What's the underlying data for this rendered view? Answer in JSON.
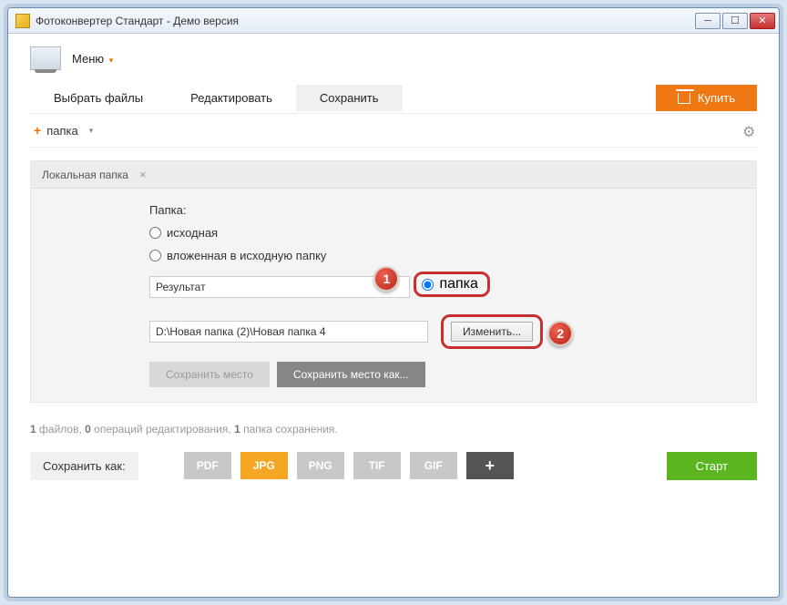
{
  "window": {
    "title": "Фотоконвертер Стандарт - Демо версия"
  },
  "menu": {
    "label": "Меню"
  },
  "tabs": {
    "select": "Выбрать файлы",
    "edit": "Редактировать",
    "save": "Сохранить"
  },
  "buy": "Купить",
  "toolbar": {
    "add_folder": "папка"
  },
  "panel": {
    "tab_label": "Локальная папка"
  },
  "form": {
    "folder_label": "Папка:",
    "radio_source": "исходная",
    "radio_nested": "вложенная в исходную папку",
    "nested_value": "Результат",
    "radio_folder": "папка",
    "path_value": "D:\\Новая папка (2)\\Новая папка 4",
    "change_btn": "Изменить...",
    "save_place": "Сохранить место",
    "save_place_as": "Сохранить место как..."
  },
  "badges": {
    "one": "1",
    "two": "2"
  },
  "status": {
    "n1": "1",
    "t1": " файлов, ",
    "n2": "0",
    "t2": " операций редактирования, ",
    "n3": "1",
    "t3": " папка сохранения."
  },
  "bottom": {
    "save_as": "Сохранить как:",
    "pdf": "PDF",
    "jpg": "JPG",
    "png": "PNG",
    "tif": "TIF",
    "gif": "GIF",
    "plus": "+",
    "start": "Старт"
  }
}
